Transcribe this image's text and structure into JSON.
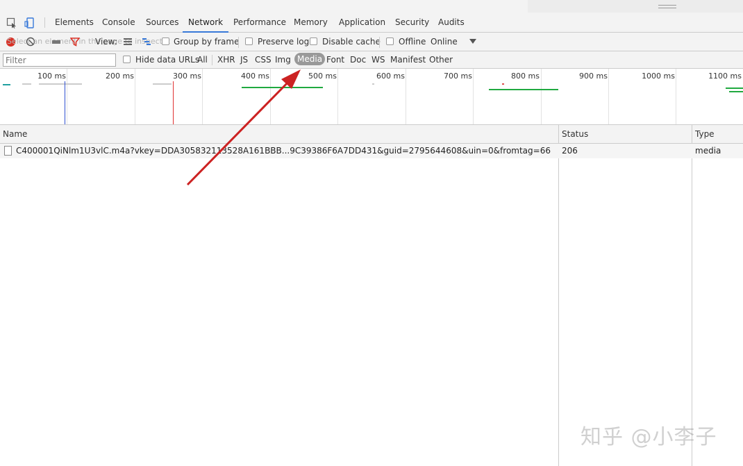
{
  "tabs": [
    {
      "label": "Elements"
    },
    {
      "label": "Console"
    },
    {
      "label": "Sources"
    },
    {
      "label": "Network",
      "active": true
    },
    {
      "label": "Performance"
    },
    {
      "label": "Memory"
    },
    {
      "label": "Application"
    },
    {
      "label": "Security"
    },
    {
      "label": "Audits"
    }
  ],
  "toolbar": {
    "inspect_hint": "Select an element in the page to inspect it",
    "view_label": "View:",
    "group_by_frame": "Group by frame",
    "preserve_log": "Preserve log",
    "disable_cache": "Disable cache",
    "offline": "Offline",
    "throttle_value": "Online"
  },
  "filter": {
    "placeholder": "Filter",
    "hide_data_urls": "Hide data URLs",
    "types": [
      "All",
      "XHR",
      "JS",
      "CSS",
      "Img",
      "Media",
      "Font",
      "Doc",
      "WS",
      "Manifest",
      "Other"
    ],
    "selected": "Media"
  },
  "overview": {
    "ticks": [
      "100 ms",
      "200 ms",
      "300 ms",
      "400 ms",
      "500 ms",
      "600 ms",
      "700 ms",
      "800 ms",
      "900 ms",
      "1000 ms",
      "1100 ms"
    ]
  },
  "table": {
    "columns": {
      "name": "Name",
      "status": "Status",
      "type": "Type"
    },
    "rows": [
      {
        "name": "C400001QiNlm1U3vlC.m4a?vkey=DDA305832113528A161BBB...9C39386F6A7DD431&guid=2795644608&uin=0&fromtag=66",
        "status": "206",
        "type": "media"
      }
    ]
  },
  "colors": {
    "accent": "#3879d9",
    "record": "#d93025",
    "annotation_arrow": "#cc2222",
    "timeline_green": "#20a940"
  },
  "watermark": "知乎 @小李子"
}
